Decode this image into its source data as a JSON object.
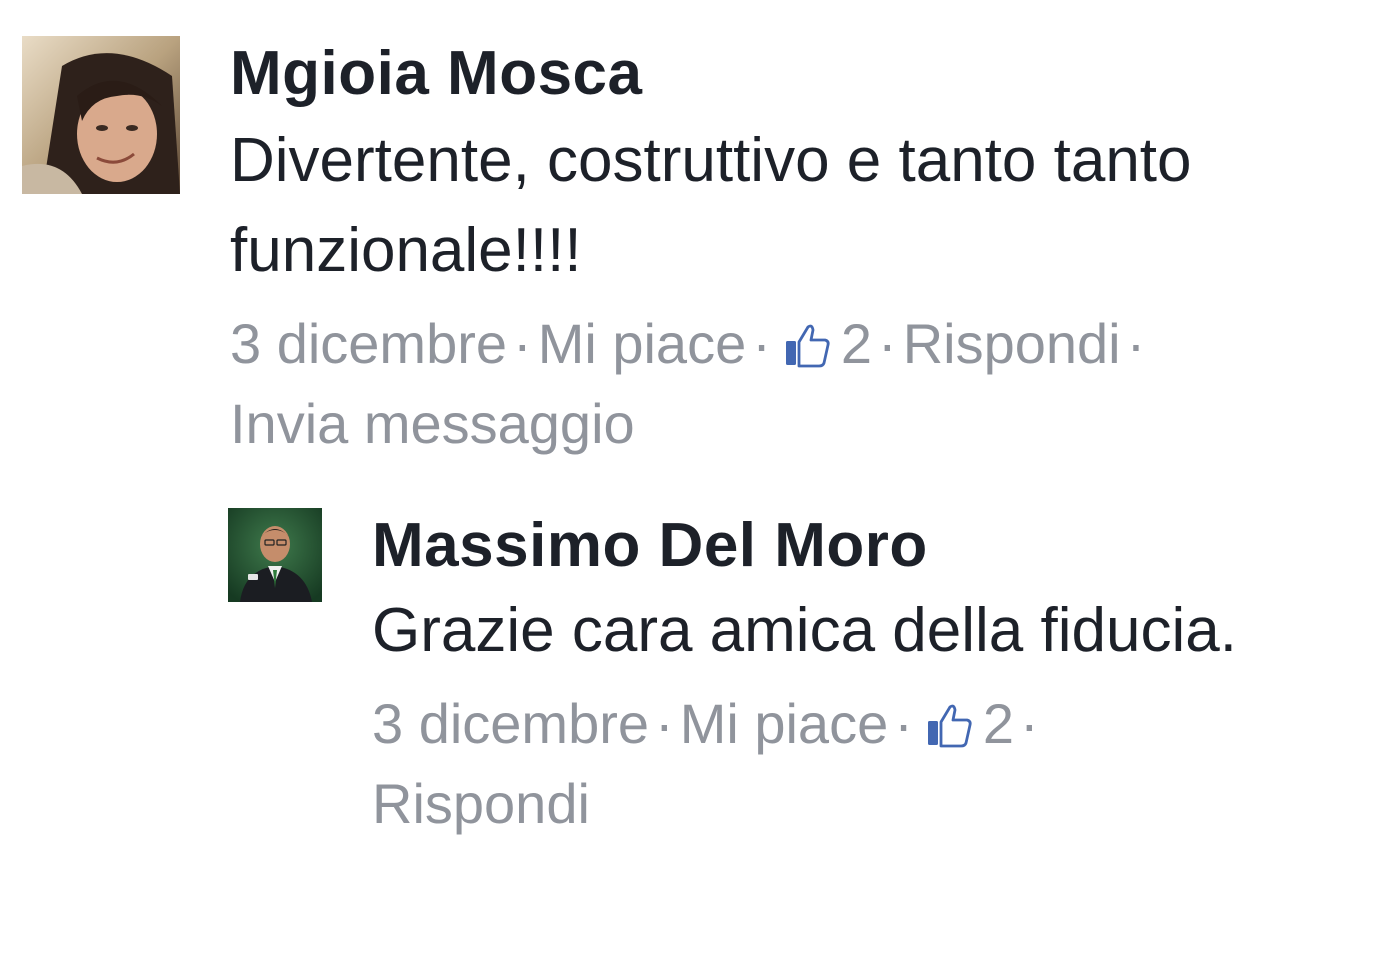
{
  "comments": [
    {
      "author": "Mgioia Mosca",
      "text": "Divertente, costruttivo e tanto tanto funzionale!!!!",
      "date": "3 dicembre",
      "like_label": "Mi piace",
      "like_count": "2",
      "reply_label": "Rispondi",
      "message_label": "Invia messaggio",
      "separator": "·"
    },
    {
      "author": "Massimo Del Moro",
      "text": "Grazie cara amica della fiducia.",
      "date": "3 dicembre",
      "like_label": "Mi piace",
      "like_count": "2",
      "reply_label": "Rispondi",
      "separator": "·"
    }
  ],
  "icons": {
    "like": "thumbs-up-icon",
    "accent_color": "#4267b2",
    "meta_color": "#90949c",
    "text_color": "#1d2129"
  }
}
